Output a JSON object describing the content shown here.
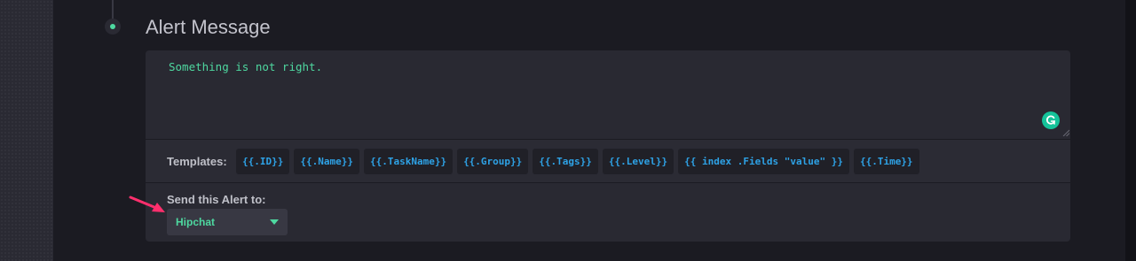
{
  "section": {
    "title": "Alert Message"
  },
  "message": {
    "text": "Something is not right."
  },
  "templates": {
    "label": "Templates:",
    "chips": [
      "{{.ID}}",
      "{{.Name}}",
      "{{.TaskName}}",
      "{{.Group}}",
      "{{.Tags}}",
      "{{.Level}}",
      "{{ index .Fields \"value\" }}",
      "{{.Time}}"
    ]
  },
  "send": {
    "label": "Send this Alert to:",
    "selected": "Hipchat"
  },
  "colors": {
    "accent_green": "#4ed8a0",
    "template_blue": "#2ea2e6",
    "annotation_pink": "#ff2f6d"
  },
  "icons": [
    "grammarly-icon",
    "chevron-down-icon",
    "annotation-arrow-icon"
  ]
}
